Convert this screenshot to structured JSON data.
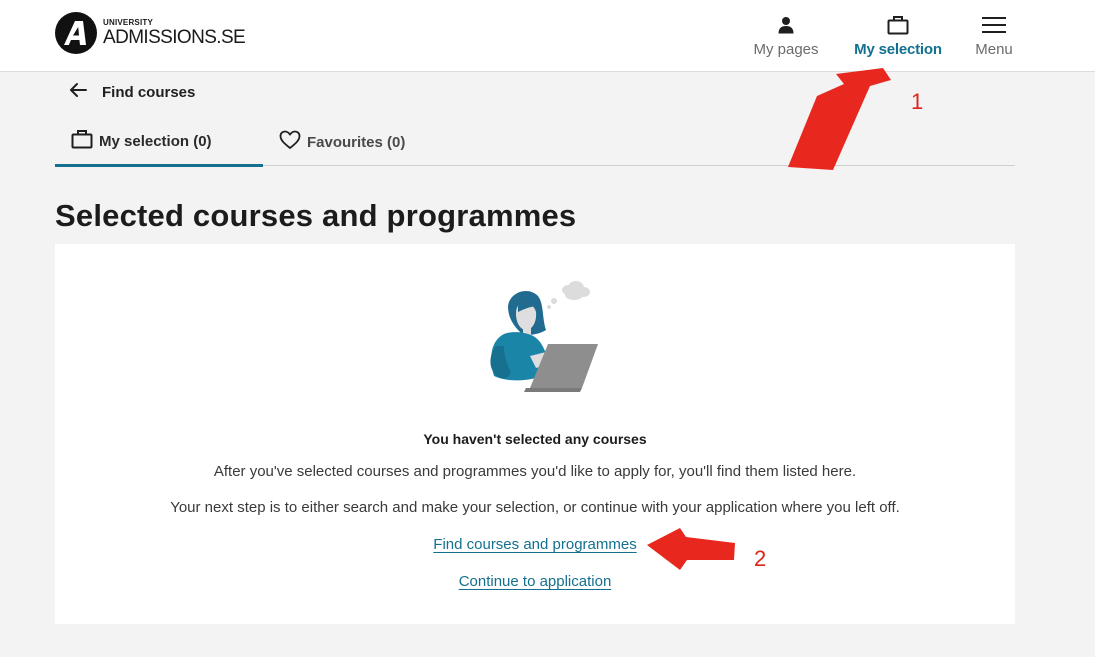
{
  "header": {
    "logo": {
      "small": "UNIVERSITY",
      "big": "ADMISSIONS.SE",
      "mark_icon": "logo-a-icon"
    },
    "nav": {
      "my_pages": {
        "label": "My pages",
        "icon": "person-icon"
      },
      "my_selection": {
        "label": "My selection",
        "icon": "briefcase-icon",
        "active": true
      },
      "menu": {
        "label": "Menu",
        "icon": "hamburger-icon"
      }
    }
  },
  "back": {
    "label": "Find courses",
    "icon": "arrow-left-icon"
  },
  "tabs": [
    {
      "label": "My selection (0)",
      "icon": "briefcase-icon",
      "active": true
    },
    {
      "label": "Favourites (0)",
      "icon": "heart-icon",
      "active": false
    }
  ],
  "page_title": "Selected courses and programmes",
  "empty_state": {
    "illustration": "person-with-laptop-illustration",
    "title": "You haven't selected any courses",
    "text1": "After you've selected courses and programmes you'd like to apply for, you'll find them listed here.",
    "text2": "Your next step is to either search and make your selection, or continue with your application where you left off.",
    "link_find": "Find courses and programmes",
    "link_continue": "Continue to application"
  },
  "annotations": {
    "marker_1": "1",
    "marker_2": "2"
  },
  "colors": {
    "accent": "#13708f",
    "annotation": "#e0231b",
    "page_bg": "#f3f3f3",
    "card_bg": "#ffffff"
  }
}
